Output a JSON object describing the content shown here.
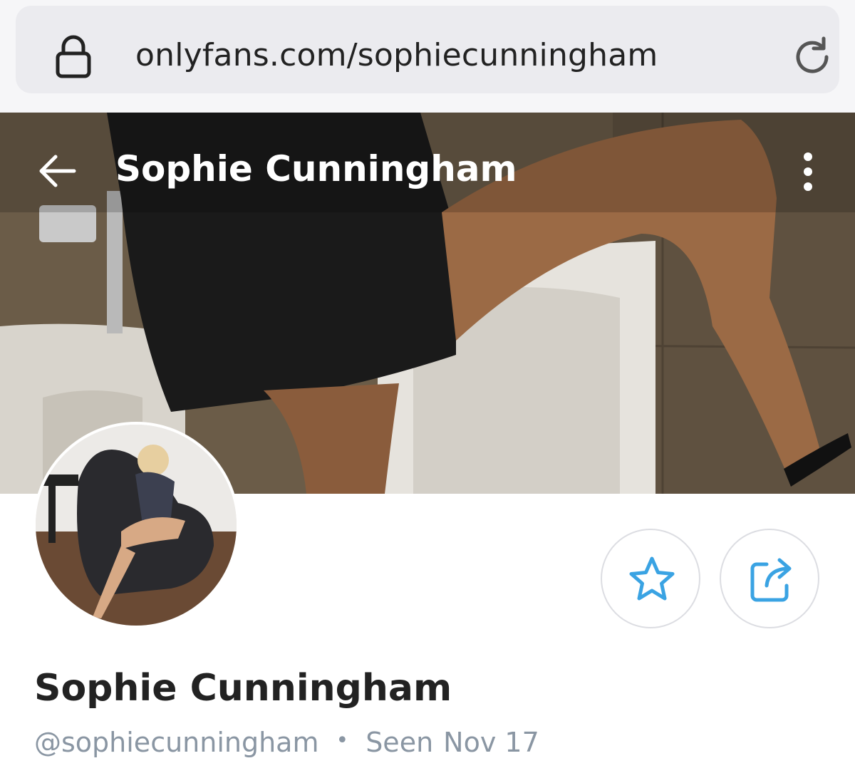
{
  "browser": {
    "url": "onlyfans.com/sophiecunningham",
    "icons": {
      "lock": "lock-icon",
      "reload": "reload-icon"
    }
  },
  "cover": {
    "title": "Sophie Cunningham",
    "icons": {
      "back": "arrow-left-icon",
      "more": "more-vertical-icon"
    }
  },
  "profile": {
    "name": "Sophie Cunningham",
    "handle": "@sophiecunningham",
    "seen_label": "Seen",
    "seen_date": "Nov 17",
    "separator": "•"
  },
  "actions": {
    "favorite_icon": "star-icon",
    "share_icon": "share-icon",
    "accent_color": "#3aa3e3"
  }
}
